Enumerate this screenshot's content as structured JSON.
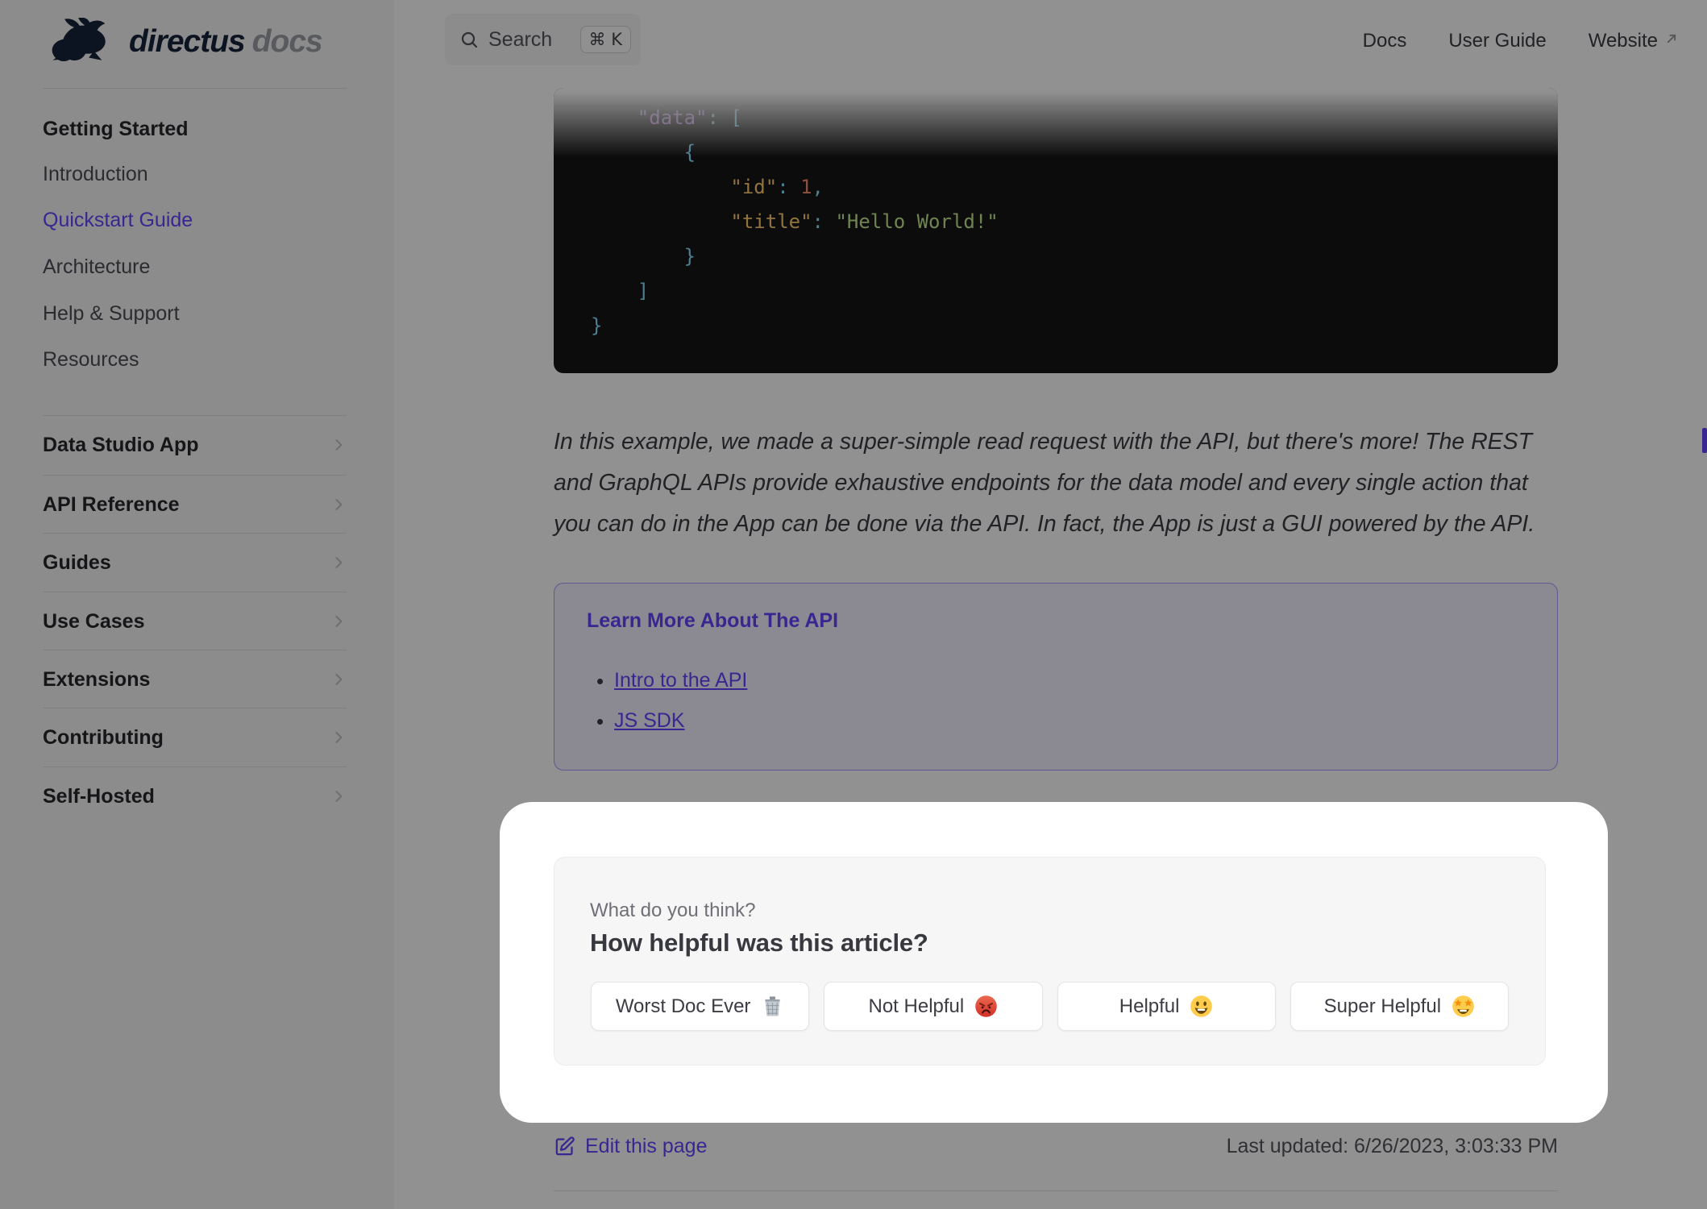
{
  "brand": {
    "name": "directus",
    "suffix": "docs"
  },
  "navbar": {
    "search": {
      "label": "Search",
      "shortcut": "⌘ K"
    },
    "links": [
      {
        "label": "Docs"
      },
      {
        "label": "User Guide"
      },
      {
        "label": "Website",
        "external": true
      }
    ]
  },
  "sidebar": {
    "section_title": "Getting Started",
    "items": [
      "Introduction",
      "Quickstart Guide",
      "Architecture",
      "Help & Support",
      "Resources"
    ],
    "active_item": "Quickstart Guide",
    "collapsed_sections": [
      "Data Studio App",
      "API Reference",
      "Guides",
      "Use Cases",
      "Extensions",
      "Contributing",
      "Self-Hosted"
    ]
  },
  "content": {
    "code": {
      "l1_ws": "    ",
      "l1_key": "\"data\"",
      "l1_rest": ": [",
      "l2": "        {",
      "l3_ws": "            ",
      "l3_key": "\"id\"",
      "l3_mid": ": ",
      "l3_num": "1",
      "l3_end": ",",
      "l4_ws": "            ",
      "l4_key": "\"title\"",
      "l4_mid": ": ",
      "l4_str": "\"Hello World!\"",
      "l5": "        }",
      "l6": "    ]",
      "l7": "}"
    },
    "paragraph": "In this example, we made a super-simple read request with the API, but there's more! The REST and GraphQL APIs provide exhaustive endpoints for the data model and every single action that you can do in the App can be done via the API. In fact, the App is just a GUI powered by the API.",
    "callout": {
      "title": "Learn More About The API",
      "links": [
        "Intro to the API",
        "JS SDK"
      ]
    }
  },
  "feedback": {
    "caption": "What do you think?",
    "title": "How helpful was this article?",
    "buttons": [
      {
        "label": "Worst Doc Ever",
        "emoji": "🗑️"
      },
      {
        "label": "Not Helpful",
        "emoji": "😡"
      },
      {
        "label": "Helpful",
        "emoji": "😃"
      },
      {
        "label": "Super Helpful",
        "emoji": "🤩"
      }
    ]
  },
  "footer": {
    "edit_label": "Edit this page",
    "last_updated": "Last updated: 6/26/2023, 3:03:33 PM"
  },
  "colors": {
    "accent": "#6644ff",
    "sidebar_bg": "#f6f6f7",
    "code_bg": "#161618",
    "code_key_outer": "#c792ea",
    "code_key_inner": "#ffcb6b",
    "code_punctuation": "#89ddff",
    "code_number": "#f78c6c",
    "code_string": "#c3e88d",
    "overlay": "rgba(0,0,0,0.43)"
  }
}
